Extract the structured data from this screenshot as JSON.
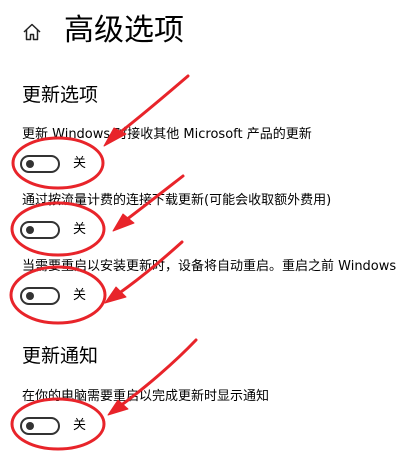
{
  "header": {
    "home_icon": "home-icon",
    "title": "高级选项"
  },
  "update_options": {
    "heading": "更新选项",
    "settings": [
      {
        "label": "更新 Windows 时接收其他 Microsoft 产品的更新",
        "state": "关",
        "on": false
      },
      {
        "label": "通过按流量计费的连接下载更新(可能会收取额外费用)",
        "state": "关",
        "on": false
      },
      {
        "label": "当需要重启以安装更新时，设备将自动重启。重启之前 Windows",
        "state": "关",
        "on": false
      }
    ]
  },
  "update_notifications": {
    "heading": "更新通知",
    "settings": [
      {
        "label": "在你的电脑需要重启以完成更新时显示通知",
        "state": "关",
        "on": false
      }
    ]
  },
  "annotation_color": "#e8242a"
}
